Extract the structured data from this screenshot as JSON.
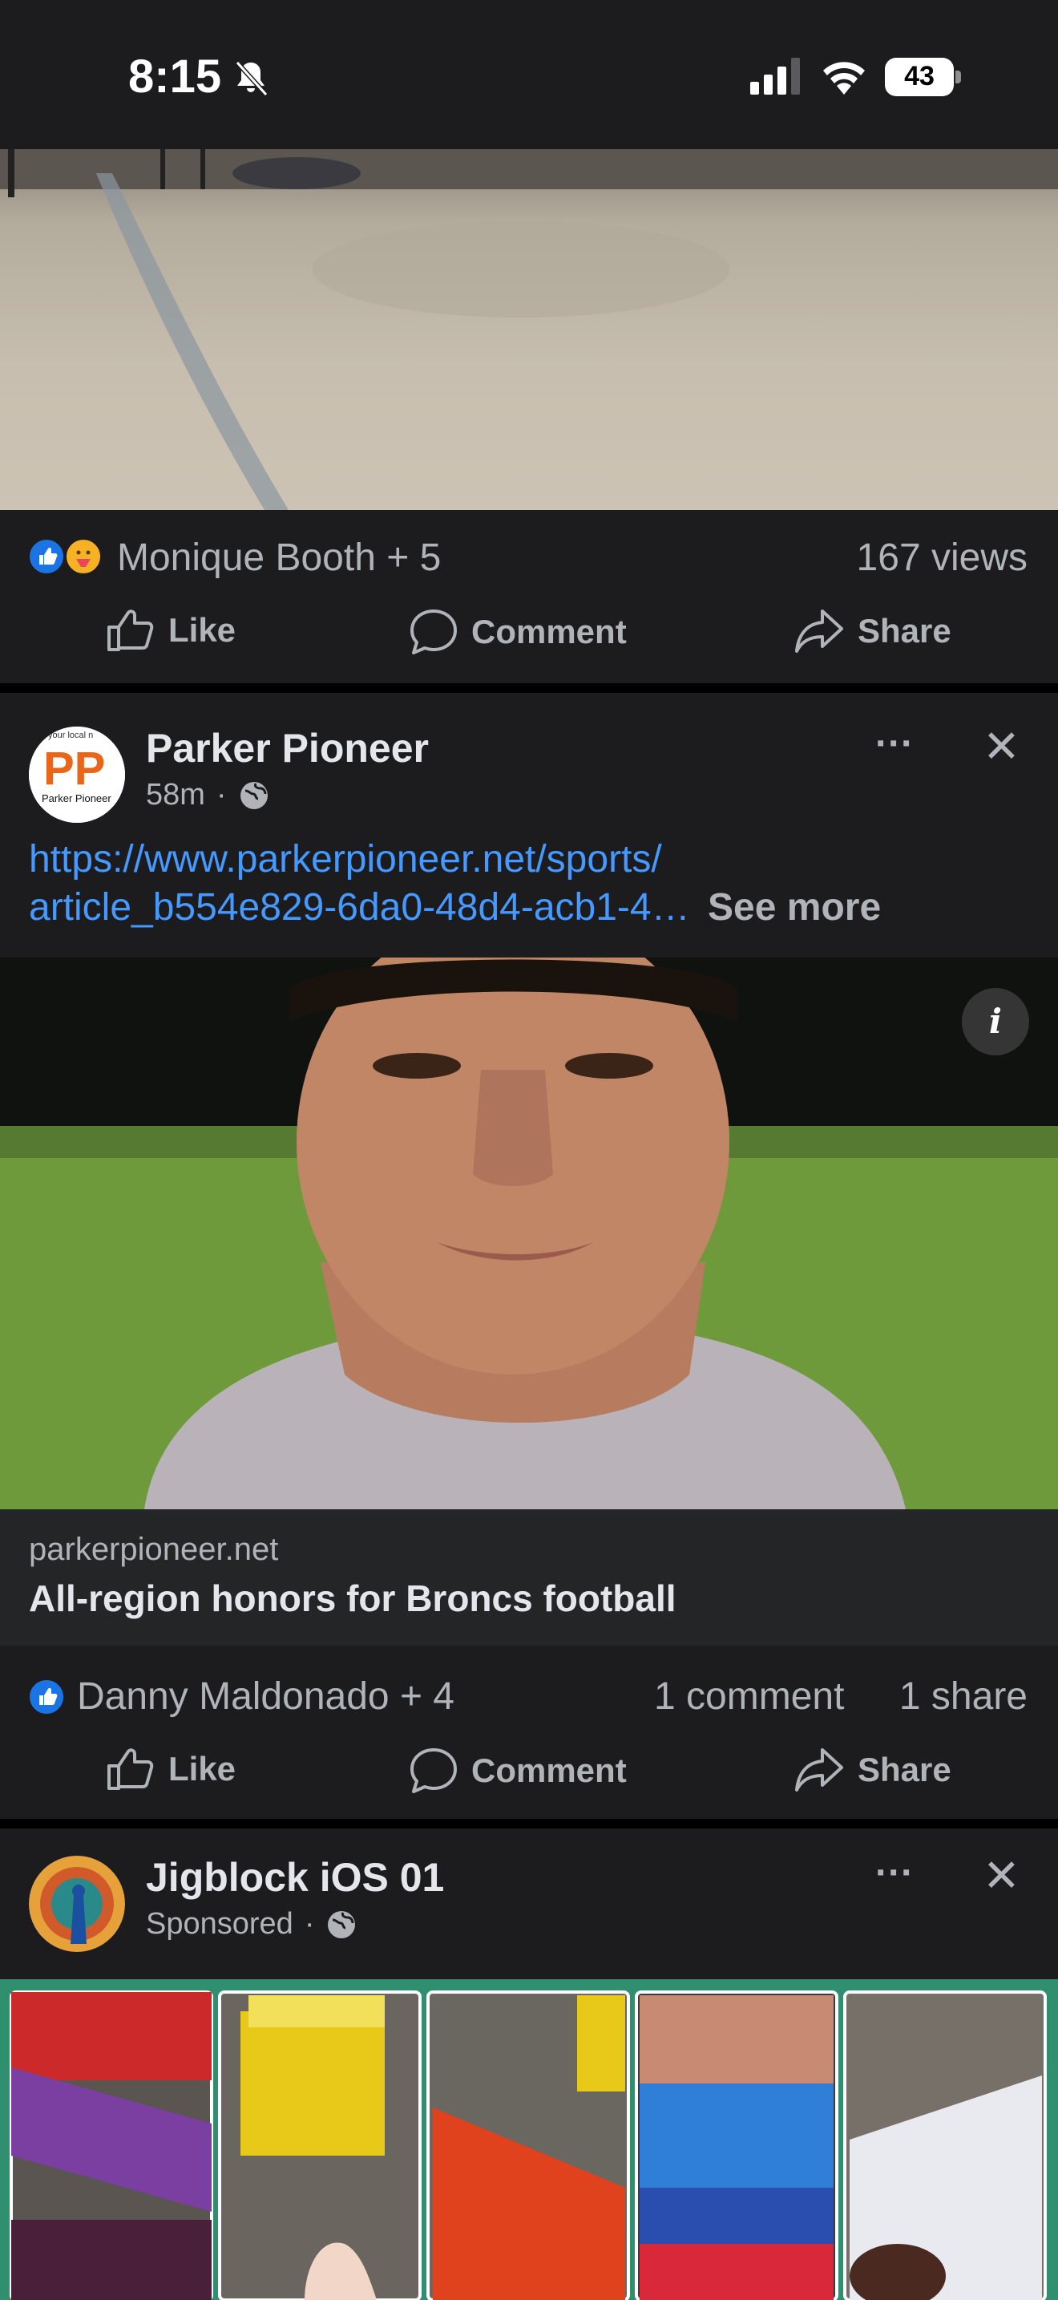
{
  "status_bar": {
    "time": "8:15",
    "battery": "43"
  },
  "post1": {
    "reactors": "Monique Booth + 5",
    "views": "167 views",
    "like_label": "Like",
    "comment_label": "Comment",
    "share_label": "Share"
  },
  "post2": {
    "page_name": "Parker Pioneer",
    "avatar_text": "PP",
    "avatar_top": "your local n",
    "avatar_sub": "Parker Pioneer",
    "time_ago": "58m",
    "link_line1": "https://www.parkerpioneer.net/sports/",
    "link_line2": "article_b554e829-6da0-48d4-acb1-4…",
    "see_more": "See more",
    "info_symbol": "i",
    "domain": "parkerpioneer.net",
    "headline": "All-region honors for Broncs football",
    "reactors": "Danny Maldonado + 4",
    "comments": "1 comment",
    "shares": "1 share",
    "like_label": "Like",
    "comment_label": "Comment",
    "share_label": "Share"
  },
  "post3": {
    "page_name": "Jigblock iOS 01",
    "sponsored": "Sponsored"
  },
  "more_symbol": "···",
  "close_symbol": "✕",
  "colors": {
    "accent": "#1b74e4",
    "link": "#4599ff",
    "background": "#1c1c1e",
    "card_border": "#2f8f6e"
  },
  "icons": [
    "bell-slash-icon",
    "cellular-signal-icon",
    "wifi-icon",
    "battery-icon",
    "like-reaction-icon",
    "care-reaction-icon",
    "thumbs-up-icon",
    "comment-icon",
    "share-icon",
    "more-icon",
    "close-icon",
    "globe-icon",
    "info-icon"
  ]
}
